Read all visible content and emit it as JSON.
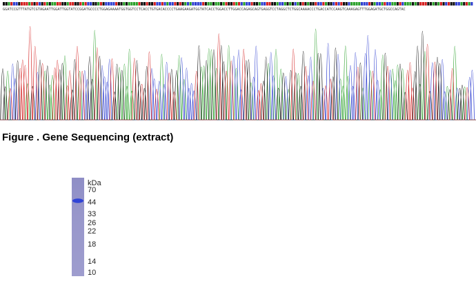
{
  "sequence": {
    "text": "GGATCCGTTTATGTCGTAGAATTGGATTGGTATCCGGATGCCCCTGGAGAAAATGGTGGTCCTCACCTGTGACACCCCTGAAGAAGATGGTATCACCTGGACCTTGGACCAGAGCAGTGAGGTCCTAGGCTCTGGCAAAACCCTGACCATCCAAGTCAAAGAGTTTGGAGATGCTGGCCAGTAC",
    "base_colors": {
      "A": "#2aa02a",
      "C": "#3040d0",
      "G": "#111111",
      "T": "#d42020"
    }
  },
  "figure": {
    "caption": "Figure . Gene Sequencing (extract)"
  },
  "gel": {
    "unit_label": "kDa",
    "markers": [
      "70",
      "44",
      "33",
      "26",
      "22",
      "18",
      "14",
      "10"
    ],
    "band_color": "#2a3fd8",
    "lane_color": "#9a99cc"
  }
}
